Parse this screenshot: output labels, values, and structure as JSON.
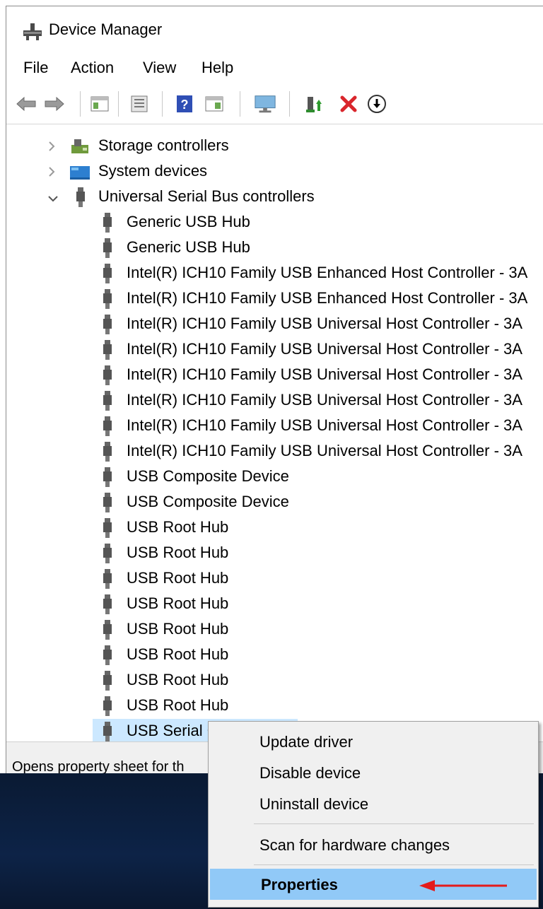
{
  "window": {
    "title": "Device Manager"
  },
  "menu": [
    "File",
    "Action",
    "View",
    "Help"
  ],
  "toolbar": {
    "buttons": [
      "back-icon",
      "forward-icon",
      "show-hide-console-tree-icon",
      "properties-icon",
      "help-icon",
      "action-pane-icon",
      "scan-hardware-icon",
      "update-driver-icon",
      "uninstall-icon",
      "disable-icon"
    ]
  },
  "tree": {
    "categories": [
      {
        "label": "Storage controllers",
        "expanded": false
      },
      {
        "label": "System devices",
        "expanded": false
      },
      {
        "label": "Universal Serial Bus controllers",
        "expanded": true
      }
    ],
    "usb_devices": [
      "Generic USB Hub",
      "Generic USB Hub",
      "Intel(R) ICH10 Family USB Enhanced Host Controller - 3A",
      "Intel(R) ICH10 Family USB Enhanced Host Controller - 3A",
      "Intel(R) ICH10 Family USB Universal Host Controller - 3A",
      "Intel(R) ICH10 Family USB Universal Host Controller - 3A",
      "Intel(R) ICH10 Family USB Universal Host Controller - 3A",
      "Intel(R) ICH10 Family USB Universal Host Controller - 3A",
      "Intel(R) ICH10 Family USB Universal Host Controller - 3A",
      "Intel(R) ICH10 Family USB Universal Host Controller - 3A",
      "USB Composite Device",
      "USB Composite Device",
      "USB Root Hub",
      "USB Root Hub",
      "USB Root Hub",
      "USB Root Hub",
      "USB Root Hub",
      "USB Root Hub",
      "USB Root Hub",
      "USB Root Hub",
      "USB Serial C"
    ],
    "selected_index": 20
  },
  "status": {
    "text": "Opens property sheet for th"
  },
  "context_menu": {
    "items": [
      "Update driver",
      "Disable device",
      "Uninstall device",
      "Scan for hardware changes",
      "Properties"
    ],
    "highlighted": "Properties"
  },
  "colors": {
    "selection": "#cce8ff",
    "menu_highlight": "#91c9f7",
    "annotation_arrow": "#e41b1b",
    "delete_red": "#d9262c"
  }
}
